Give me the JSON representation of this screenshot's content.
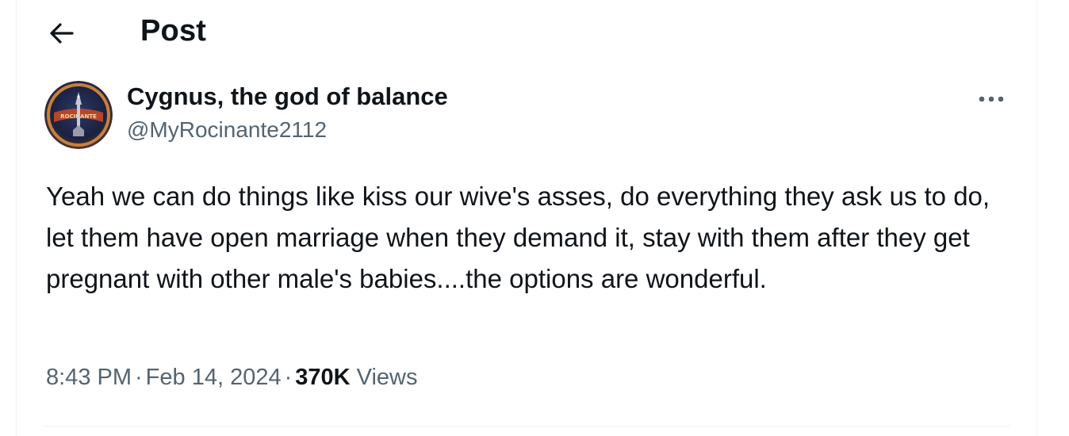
{
  "header": {
    "title": "Post",
    "back_icon": "arrow-left-icon"
  },
  "post": {
    "author": {
      "display_name": "Cygnus, the god of balance",
      "handle": "@MyRocinante2112",
      "avatar_text": "ROCINANTE"
    },
    "more_icon": "more-horizontal-icon",
    "text": "Yeah we can do things like kiss our wive's asses, do everything they ask us to do, let them have open marriage when they demand it, stay with them after they get pregnant with other male's babies....the options are wonderful.",
    "time": "8:43 PM",
    "separator": "·",
    "date": "Feb 14, 2024",
    "views_count": "370K",
    "views_label": "Views"
  },
  "colors": {
    "text_primary": "#0f1419",
    "text_secondary": "#536471",
    "border": "#eff3f4"
  }
}
